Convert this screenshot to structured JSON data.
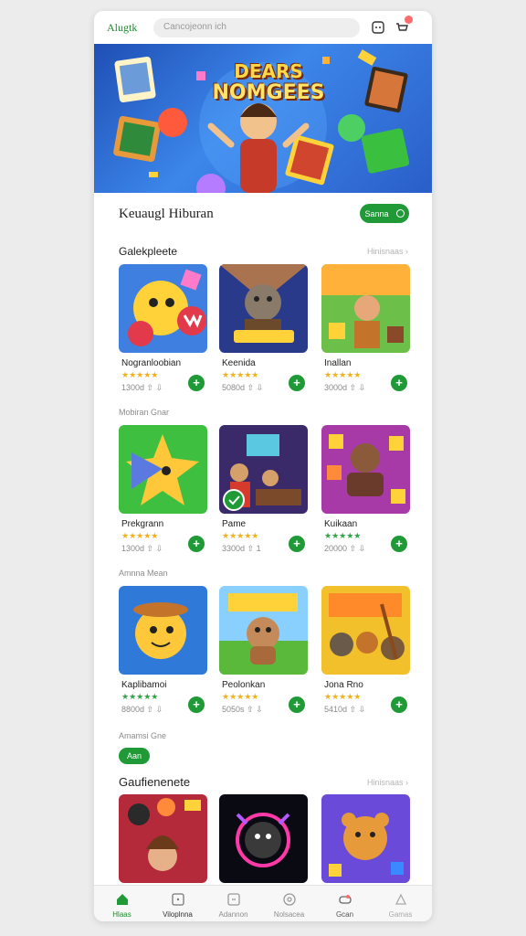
{
  "topbar": {
    "brand": "Alugtk",
    "search_placeholder": "Cancojeonn ich"
  },
  "hero": {
    "title_line1": "DEARS",
    "title_line2": "NOMGEES",
    "accent_color": "#ffd84a"
  },
  "category": {
    "title": "Keuaugl Hiburan",
    "button_label": "Sanna"
  },
  "sections": [
    {
      "title": "Galekpleete",
      "see_all": "Hinisnaas",
      "apps": [
        {
          "name": "Nogranloobian",
          "stars": "★★★★★",
          "meta": "1300d  ⇧ ⇩"
        },
        {
          "name": "Keenida",
          "stars": "★★★★★",
          "meta": "5080d  ⇧ ⇩"
        },
        {
          "name": "Inallan",
          "stars": "★★★★★",
          "meta": "3000d  ⇧ ⇩"
        }
      ]
    },
    {
      "label": "Mobiran Gnar",
      "apps": [
        {
          "name": "Prekgrann",
          "stars": "★★★★★",
          "meta": "1300d  ⇧ ⇩"
        },
        {
          "name": "Pame",
          "stars": "★★★★★",
          "meta": "3300d  ⇧ 1"
        },
        {
          "name": "Kuikaan",
          "stars": "★★★★★",
          "meta": "20000  ⇧ ⇩"
        }
      ]
    },
    {
      "label": "Amnna Mean",
      "apps": [
        {
          "name": "Kaplibamoi",
          "stars": "★★★★★",
          "meta": "8800d  ⇧ ⇩"
        },
        {
          "name": "Peolonkan",
          "stars": "★★★★★",
          "meta": "5050s  ⇧ ⇩"
        },
        {
          "name": "Jona Rno",
          "stars": "★★★★★",
          "meta": "5410d  ⇧ ⇩"
        }
      ]
    },
    {
      "label": "Amamsi Gne",
      "pill": "Aan"
    },
    {
      "title": "Gaufienenete",
      "see_all": "Hinisnaas"
    }
  ],
  "bottom_nav": [
    {
      "label": "Hlaas",
      "icon": "home-icon",
      "active": true
    },
    {
      "label": "Viloplnna",
      "icon": "grid-icon"
    },
    {
      "label": "Adannon",
      "icon": "apps-icon"
    },
    {
      "label": "Nolsacea",
      "icon": "clock-icon"
    },
    {
      "label": "Gcan",
      "icon": "gamepad-icon"
    },
    {
      "label": "Gamas",
      "icon": "profile-icon"
    }
  ],
  "colors": {
    "brand_green": "#1f9a36",
    "star_gold": "#f2b01e"
  }
}
